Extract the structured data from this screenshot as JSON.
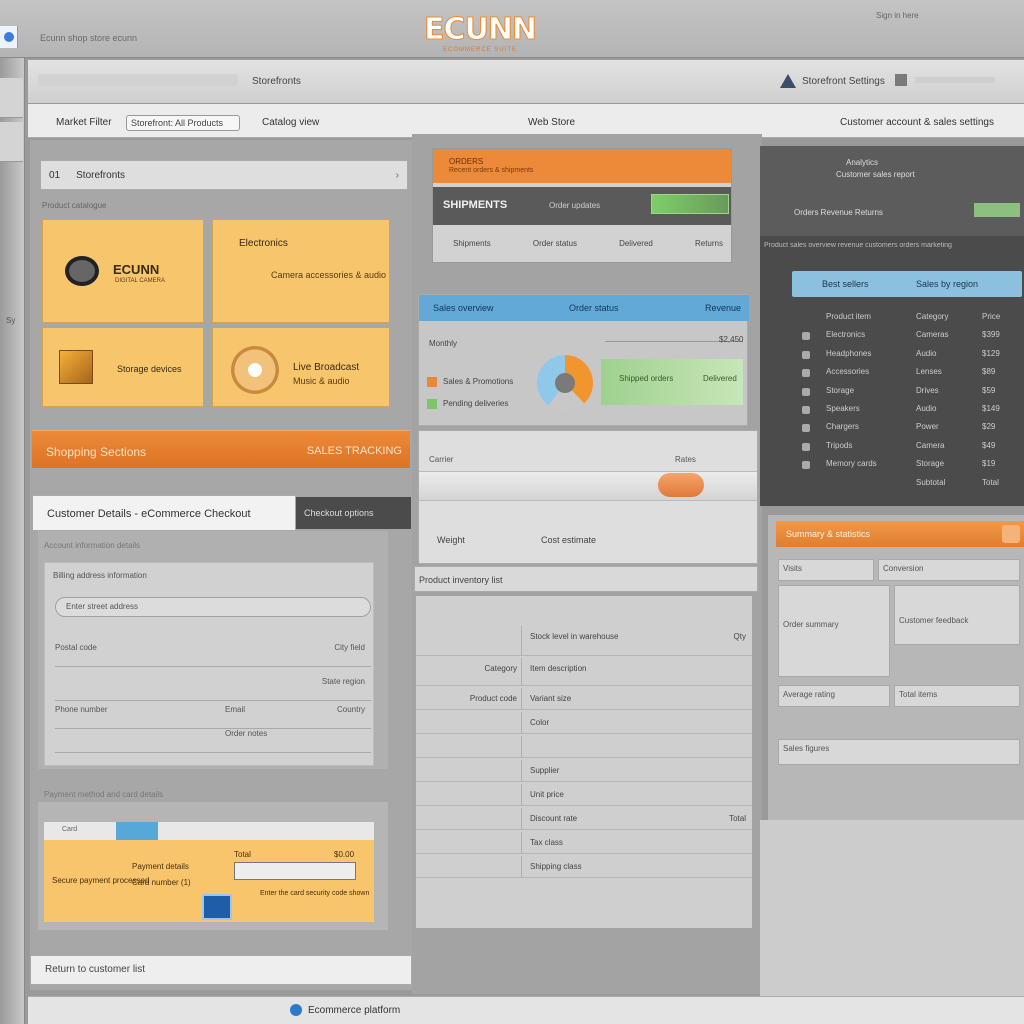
{
  "app": {
    "logo_text": "ECUNN",
    "logo_tagline": "ECOMMERCE SUITE",
    "url_text": "Ecunn shop  store  ecunn",
    "user_label": "Sign in here"
  },
  "toolbar": {
    "title": "Storefronts",
    "right_label": "Storefront Settings"
  },
  "subbar": {
    "label_left": "Market Filter",
    "filter_value": "Storefront: All Products",
    "label_mid": "Catalog view",
    "label_center": "Web Store",
    "label_right": "Customer account & sales settings"
  },
  "rail": {
    "label": "Sy"
  },
  "products": {
    "section_num": "01",
    "section_title": "Storefronts",
    "section_chevron": "›",
    "section_sub": "Product catalogue",
    "card1_title": "ECUNN",
    "card1_sub": "DIGITAL CAMERA",
    "card2_title": "Electronics",
    "card2_sub": "Camera accessories & audio",
    "card3_title": "Storage devices",
    "card4_title": "Live Broadcast",
    "card4_sub": "Music & audio"
  },
  "promo_bar": {
    "left": "Shopping  Sections",
    "right": "SALES TRACKING"
  },
  "checkout": {
    "tab_label": "Customer Details - eCommerce Checkout",
    "tab_dark": "Checkout options",
    "caption": "Account information details",
    "box_caption": "Billing address information",
    "input_value": "Enter street address",
    "rows": [
      {
        "c1": "Postal code",
        "c2": "",
        "c3": "City field"
      },
      {
        "c1": "",
        "c2": "",
        "c3": "State region"
      },
      {
        "c1": "Phone number",
        "c2": "Email",
        "c3": "Country"
      },
      {
        "c1": "",
        "c2": "Order notes",
        "c3": ""
      }
    ]
  },
  "payment": {
    "caption": "Payment method and card details",
    "strip_label": "Card",
    "title_a": "Payment details",
    "title_b": "Total",
    "title_c": "$0.00",
    "field_a": "Secure payment  processed",
    "field_b": "Card number (1)",
    "note": "Enter the card security code shown"
  },
  "left_footer": "Return to customer list",
  "shipment": {
    "top_a": "ORDERS",
    "top_b": "Recent orders & shipments",
    "dark_title": "SHIPMENTS",
    "dark_sub": "Order updates",
    "meta": [
      "Shipments",
      "Order status",
      "Delivered",
      "Returns"
    ]
  },
  "orders": {
    "head_left": "Sales overview",
    "head_mid": "Order status",
    "head_right": "Revenue",
    "sub_label": "Monthly",
    "amount": "$2,450",
    "rows": [
      "Sales & Promotions",
      "Pending deliveries"
    ],
    "green_a": "Shipped orders",
    "green_b": "Delivered",
    "donut_values": [
      38,
      22,
      40
    ],
    "donut_colors": [
      "#f1952f",
      "#c8c8c8",
      "#8fc8e8"
    ]
  },
  "shipping": {
    "top_left": "Carrier",
    "top_right": "Rates",
    "slider_value": 0.82,
    "row2a": "Weight",
    "row2b": "Cost estimate"
  },
  "table": {
    "head": "Product inventory list",
    "rows": [
      {
        "c1": "",
        "c2": "Stock level  in warehouse",
        "rv": "Qty"
      },
      {
        "c1": "Category",
        "c2": "Item description",
        "rv": ""
      },
      {
        "c1": "Product code",
        "c2": "Variant size",
        "rv": ""
      },
      {
        "c1": "",
        "c2": "Color",
        "rv": ""
      },
      {
        "c1": "",
        "c2": "",
        "rv": ""
      },
      {
        "c1": "",
        "c2": "Supplier",
        "rv": ""
      },
      {
        "c1": "",
        "c2": "Unit price",
        "rv": ""
      },
      {
        "c1": "",
        "c2": "Discount rate",
        "rv": "Total"
      },
      {
        "c1": "",
        "c2": "Tax class",
        "rv": ""
      },
      {
        "c1": "",
        "c2": "Shipping class",
        "rv": ""
      }
    ]
  },
  "dashboard": {
    "head_a": "Analytics",
    "head_b": "Customer sales report",
    "head_c": "Orders  Revenue  Returns",
    "sub": "Product  sales  overview  revenue  customers  orders  marketing",
    "blue_left": "Best sellers",
    "blue_right": "Sales by region",
    "rows": [
      {
        "a": "Product item",
        "b": "Category",
        "c": "Price"
      },
      {
        "a": "Electronics",
        "b": "Cameras",
        "c": "$399"
      },
      {
        "a": "Headphones",
        "b": "Audio",
        "c": "$129"
      },
      {
        "a": "Accessories",
        "b": "Lenses",
        "c": "$89"
      },
      {
        "a": "Storage",
        "b": "Drives",
        "c": "$59"
      },
      {
        "a": "Speakers",
        "b": "Audio",
        "c": "$149"
      },
      {
        "a": "Chargers",
        "b": "Power",
        "c": "$29"
      },
      {
        "a": "Tripods",
        "b": "Camera",
        "c": "$49"
      },
      {
        "a": "Memory cards",
        "b": "Storage",
        "c": "$19"
      },
      {
        "a": "",
        "b": "Subtotal",
        "c": "Total"
      }
    ]
  },
  "summary": {
    "head": "Summary & statistics",
    "cells": [
      "Visits",
      "Conversion",
      "Order summary",
      "Customer feedback",
      "Average rating",
      "Total items",
      "Sales figures"
    ]
  },
  "bottom": {
    "text": "Ecommerce platform"
  }
}
